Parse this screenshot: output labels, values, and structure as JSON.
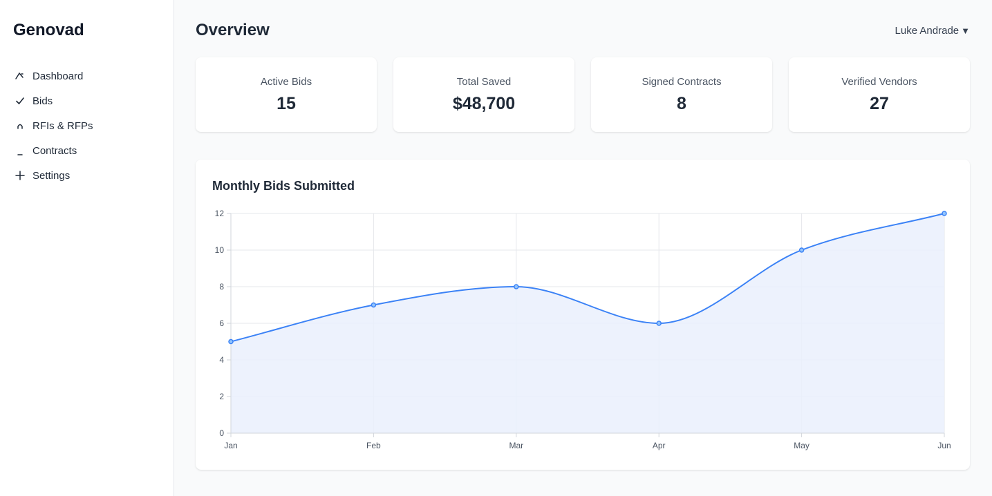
{
  "brand": "Genovad",
  "nav": [
    {
      "label": "Dashboard",
      "icon": "dashboard-icon"
    },
    {
      "label": "Bids",
      "icon": "check-icon"
    },
    {
      "label": "RFIs & RFPs",
      "icon": "arch-icon"
    },
    {
      "label": "Contracts",
      "icon": "underscore-icon"
    },
    {
      "label": "Settings",
      "icon": "plus-icon"
    }
  ],
  "header": {
    "title": "Overview",
    "user": "Luke Andrade",
    "caret": "▼"
  },
  "stats": [
    {
      "label": "Active Bids",
      "value": "15"
    },
    {
      "label": "Total Saved",
      "value": "$48,700"
    },
    {
      "label": "Signed Contracts",
      "value": "8"
    },
    {
      "label": "Verified Vendors",
      "value": "27"
    }
  ],
  "chart_data": {
    "type": "area",
    "title": "Monthly Bids Submitted",
    "categories": [
      "Jan",
      "Feb",
      "Mar",
      "Apr",
      "May",
      "Jun"
    ],
    "values": [
      5,
      7,
      8,
      6,
      10,
      12
    ],
    "ylim": [
      0,
      12
    ],
    "yticks": [
      0,
      2,
      4,
      6,
      8,
      10,
      12
    ],
    "grid": true,
    "xlabel": "",
    "ylabel": "",
    "line_color": "#3b82f6",
    "fill_color": "#eaf0fd"
  }
}
